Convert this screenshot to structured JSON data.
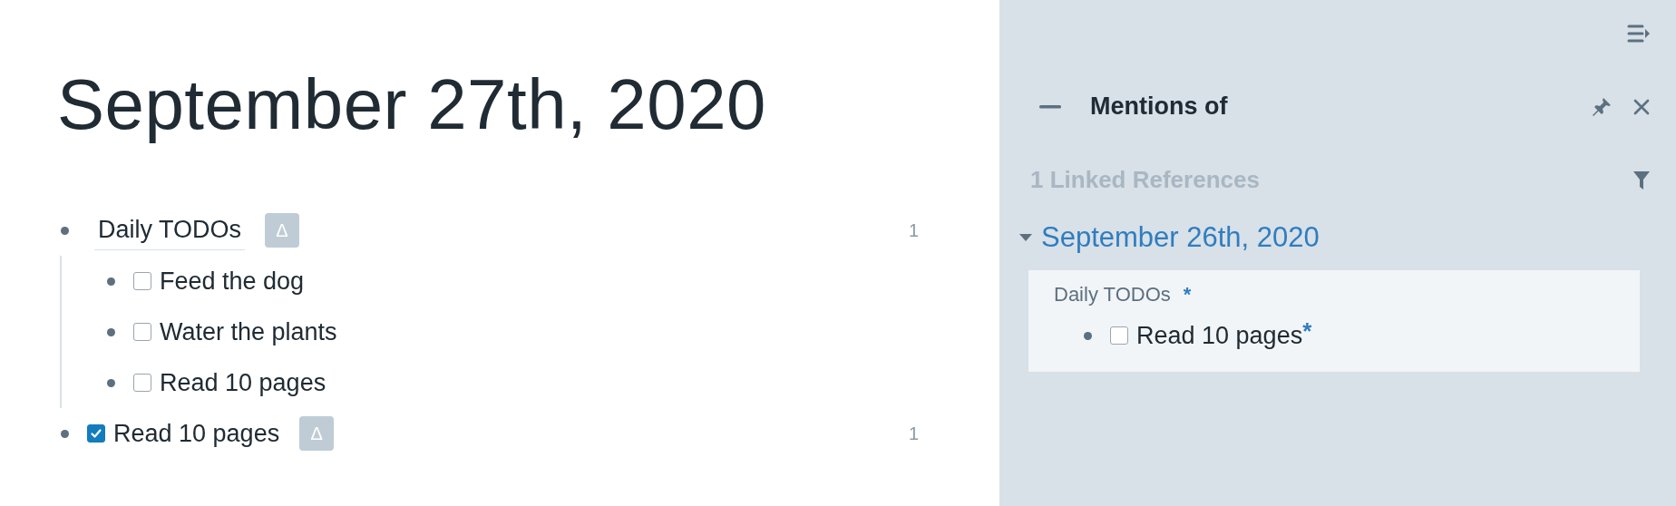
{
  "page": {
    "title": "September 27th, 2020",
    "blocks": [
      {
        "kind": "text",
        "text": "Daily TODOs",
        "delta": "Δ",
        "count": "1",
        "children": [
          {
            "kind": "todo",
            "checked": false,
            "text": "Feed the dog"
          },
          {
            "kind": "todo",
            "checked": false,
            "text": "Water the plants"
          },
          {
            "kind": "todo",
            "checked": false,
            "text": "Read 10 pages"
          }
        ]
      },
      {
        "kind": "todo",
        "checked": true,
        "text": "Read 10 pages",
        "delta": "Δ",
        "count": "1"
      }
    ]
  },
  "sidebar": {
    "title": "Mentions of",
    "references_label": "1 Linked References",
    "group": {
      "title": "September 26th, 2020",
      "expanded": true,
      "breadcrumb": "Daily TODOs",
      "breadcrumb_mark": "*",
      "block": {
        "kind": "todo",
        "checked": false,
        "text": "Read 10 pages",
        "mark": "*"
      }
    }
  }
}
